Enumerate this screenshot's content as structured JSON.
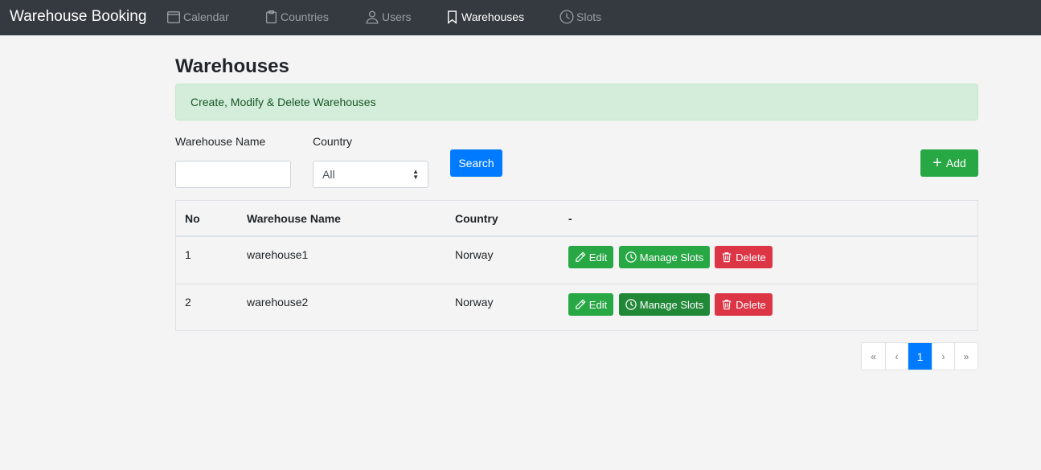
{
  "navbar": {
    "brand": "Warehouse Booking",
    "items": [
      {
        "label": "Calendar",
        "icon": "calendar-icon"
      },
      {
        "label": "Countries",
        "icon": "clipboard-icon"
      },
      {
        "label": "Users",
        "icon": "user-icon"
      },
      {
        "label": "Warehouses",
        "icon": "bookmark-icon",
        "active": true
      },
      {
        "label": "Slots",
        "icon": "clock-icon"
      }
    ]
  },
  "page": {
    "title": "Warehouses",
    "alert": "Create, Modify & Delete Warehouses"
  },
  "filters": {
    "name_label": "Warehouse Name",
    "name_value": "",
    "country_label": "Country",
    "country_selected": "All",
    "search_label": "Search",
    "add_label": "Add"
  },
  "table": {
    "headers": [
      "No",
      "Warehouse Name",
      "Country",
      "-"
    ],
    "rows": [
      {
        "no": "1",
        "name": "warehouse1",
        "country": "Norway"
      },
      {
        "no": "2",
        "name": "warehouse2",
        "country": "Norway"
      }
    ],
    "actions": {
      "edit": "Edit",
      "manage": "Manage Slots",
      "delete": "Delete"
    }
  },
  "pagination": {
    "first": "«",
    "prev": "‹",
    "current": "1",
    "next": "›",
    "last": "»"
  },
  "colors": {
    "navbar": "#343a40",
    "primary": "#007bff",
    "success": "#28a745",
    "danger": "#dc3545",
    "alert_bg": "#d4eddb"
  }
}
